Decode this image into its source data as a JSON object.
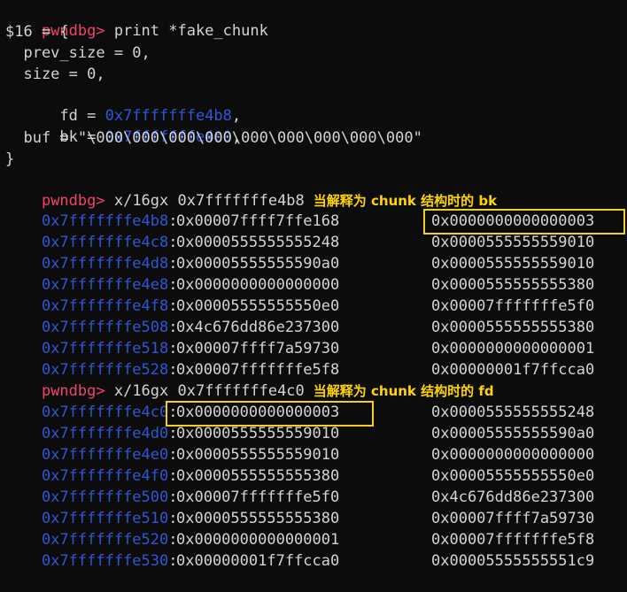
{
  "prompt": "pwndbg>",
  "print_cmd": " print *fake_chunk",
  "struct": {
    "header": "$16 = {",
    "prev_size": "  prev_size = 0,",
    "size": "  size = 0,",
    "fd_label": "  fd = ",
    "fd_value": "0x7fffffffe4b8",
    "bk_label": "  bk = ",
    "bk_value": "0x7fffffffe4c0",
    "comma": ",",
    "buf": "  buf = \"\\000\\000\\000\\000\\000\\000\\000\\000\\000\"",
    "close": "}"
  },
  "dump1": {
    "cmd": " x/16gx 0x7fffffffe4b8",
    "note": "当解释为 chunk 结构时的 bk",
    "rows": [
      {
        "addr": "0x7fffffffe4b8",
        "v1": "0x00007ffff7ffe168",
        "v2": "0x0000000000000003"
      },
      {
        "addr": "0x7fffffffe4c8",
        "v1": "0x0000555555555248",
        "v2": "0x0000555555559010"
      },
      {
        "addr": "0x7fffffffe4d8",
        "v1": "0x00005555555590a0",
        "v2": "0x0000555555559010"
      },
      {
        "addr": "0x7fffffffe4e8",
        "v1": "0x0000000000000000",
        "v2": "0x0000555555555380"
      },
      {
        "addr": "0x7fffffffe4f8",
        "v1": "0x00005555555550e0",
        "v2": "0x00007fffffffe5f0"
      },
      {
        "addr": "0x7fffffffe508",
        "v1": "0x4c676dd86e237300",
        "v2": "0x0000555555555380"
      },
      {
        "addr": "0x7fffffffe518",
        "v1": "0x00007ffff7a59730",
        "v2": "0x0000000000000001"
      },
      {
        "addr": "0x7fffffffe528",
        "v1": "0x00007fffffffe5f8",
        "v2": "0x00000001f7ffcca0"
      }
    ]
  },
  "dump2": {
    "cmd": " x/16gx 0x7fffffffe4c0",
    "note": "当解释为 chunk 结构时的 fd",
    "rows": [
      {
        "addr": "0x7fffffffe4c0",
        "v1": "0x0000000000000003",
        "v2": "0x0000555555555248"
      },
      {
        "addr": "0x7fffffffe4d0",
        "v1": "0x0000555555559010",
        "v2": "0x00005555555590a0"
      },
      {
        "addr": "0x7fffffffe4e0",
        "v1": "0x0000555555559010",
        "v2": "0x0000000000000000"
      },
      {
        "addr": "0x7fffffffe4f0",
        "v1": "0x0000555555555380",
        "v2": "0x00005555555550e0"
      },
      {
        "addr": "0x7fffffffe500",
        "v1": "0x00007fffffffe5f0",
        "v2": "0x4c676dd86e237300"
      },
      {
        "addr": "0x7fffffffe510",
        "v1": "0x0000555555555380",
        "v2": "0x00007ffff7a59730"
      },
      {
        "addr": "0x7fffffffe520",
        "v1": "0x0000000000000001",
        "v2": "0x00007fffffffe5f8"
      },
      {
        "addr": "0x7fffffffe530",
        "v1": "0x00000001f7ffcca0",
        "v2": "0x00005555555551c9"
      }
    ]
  },
  "colors": {
    "prompt": "#f2426c",
    "address": "#2f56d6",
    "annotation": "#ffd400",
    "highlight_box": "#f0d01c",
    "background": "#0c0c0c"
  }
}
